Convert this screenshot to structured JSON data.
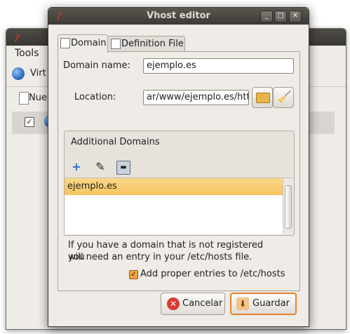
{
  "background_window": {
    "menu": "Tools",
    "row_label": "Virt",
    "new_label": "Nue"
  },
  "dialog": {
    "title": "Vhost editor",
    "window_controls": [
      "minimize-icon",
      "maximize-icon",
      "close-icon"
    ],
    "tabs": [
      {
        "label": "Domain",
        "active": true
      },
      {
        "label": "Definition File",
        "active": false
      }
    ],
    "domain_name_label": "Domain name:",
    "domain_name_value": "ejemplo.es",
    "location_label": "Location:",
    "location_value": "ar/www/ejemplo.es/http",
    "additional_domains": {
      "title": "Additional Domains",
      "toolbar_icons": [
        "add-icon",
        "edit-icon",
        "remove-icon"
      ],
      "items": [
        "ejemplo.es"
      ]
    },
    "info_line1": "If you have a domain that is not registered you",
    "info_line2": "will need an entry in your /etc/hosts file.",
    "hosts_checkbox_label": "Add proper entries to /etc/hosts",
    "hosts_checkbox_checked": true,
    "cancel_label": "Cancelar",
    "save_label": "Guardar"
  },
  "colors": {
    "selection": "#f5c35e",
    "default_button_border": "#e2852d",
    "titlebar": "#3c3a36"
  }
}
